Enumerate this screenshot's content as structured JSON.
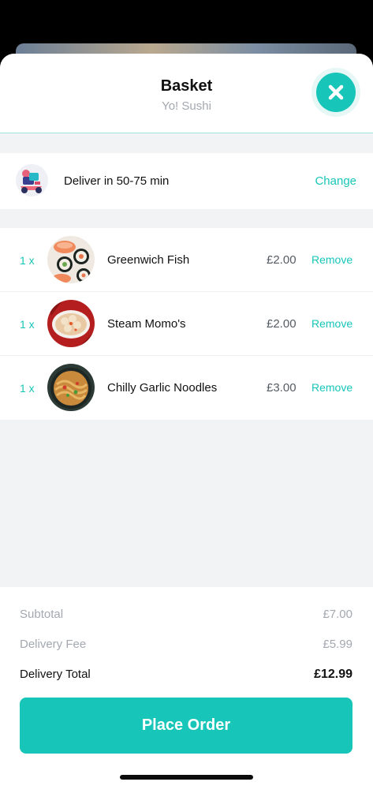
{
  "header": {
    "title": "Basket",
    "subtitle": "Yo! Sushi",
    "close_icon": "close-icon"
  },
  "delivery": {
    "text": "Deliver in 50-75 min",
    "change_label": "Change",
    "avatar_icon": "delivery-scooter-icon"
  },
  "items": [
    {
      "qty": "1 x",
      "name": "Greenwich Fish",
      "price": "£2.00",
      "remove_label": "Remove"
    },
    {
      "qty": "1 x",
      "name": "Steam Momo's",
      "price": "£2.00",
      "remove_label": "Remove"
    },
    {
      "qty": "1 x",
      "name": "Chilly Garlic Noodles",
      "price": "£3.00",
      "remove_label": "Remove"
    }
  ],
  "summary": {
    "subtotal_label": "Subtotal",
    "subtotal_value": "£7.00",
    "fee_label": "Delivery Fee",
    "fee_value": "£5.99",
    "total_label": "Delivery Total",
    "total_value": "£12.99"
  },
  "place_order_label": "Place Order",
  "colors": {
    "accent": "#17c6b8",
    "muted_text": "#a3a8b0",
    "background": "#f2f3f5"
  }
}
